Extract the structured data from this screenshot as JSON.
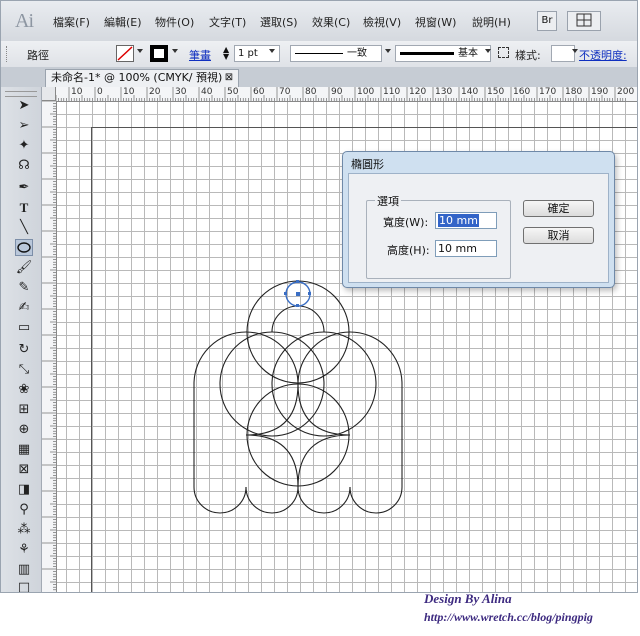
{
  "app": {
    "logo": "Ai"
  },
  "menu": {
    "items": [
      "檔案(F)",
      "編輯(E)",
      "物件(O)",
      "文字(T)",
      "選取(S)",
      "效果(C)",
      "檢視(V)",
      "視窗(W)",
      "說明(H)"
    ],
    "bridge_label": "Br"
  },
  "control": {
    "object_label": "路徑",
    "stroke_label": "筆畫",
    "stroke_weight": "1 pt",
    "profile_label": "一致",
    "brush_label": "基本",
    "style_label": "樣式:",
    "opacity_label": "不透明度:"
  },
  "document": {
    "tab_title": "未命名-1* @ 100% (CMYK/ 預視)",
    "close_glyph": "⊠"
  },
  "ruler": {
    "top_labels": [
      "10",
      "0",
      "10",
      "20",
      "30",
      "40",
      "50",
      "60",
      "70",
      "80",
      "90",
      "100",
      "110",
      "120",
      "130",
      "140",
      "150",
      "160",
      "170",
      "180",
      "190",
      "200"
    ]
  },
  "dialog": {
    "title": "橢圓形",
    "group_label": "選項",
    "width_label": "寬度(W):",
    "width_value": "10 mm",
    "height_label": "高度(H):",
    "height_value": "10 mm",
    "ok_label": "確定",
    "cancel_label": "取消"
  },
  "watermark": {
    "line1": "Design By Alina",
    "line2": "http://www.wretch.cc/blog/pingpig"
  },
  "colors": {
    "selection": "#3264c8",
    "guide_circle": "#3a6ec4",
    "art_stroke": "#222222"
  }
}
